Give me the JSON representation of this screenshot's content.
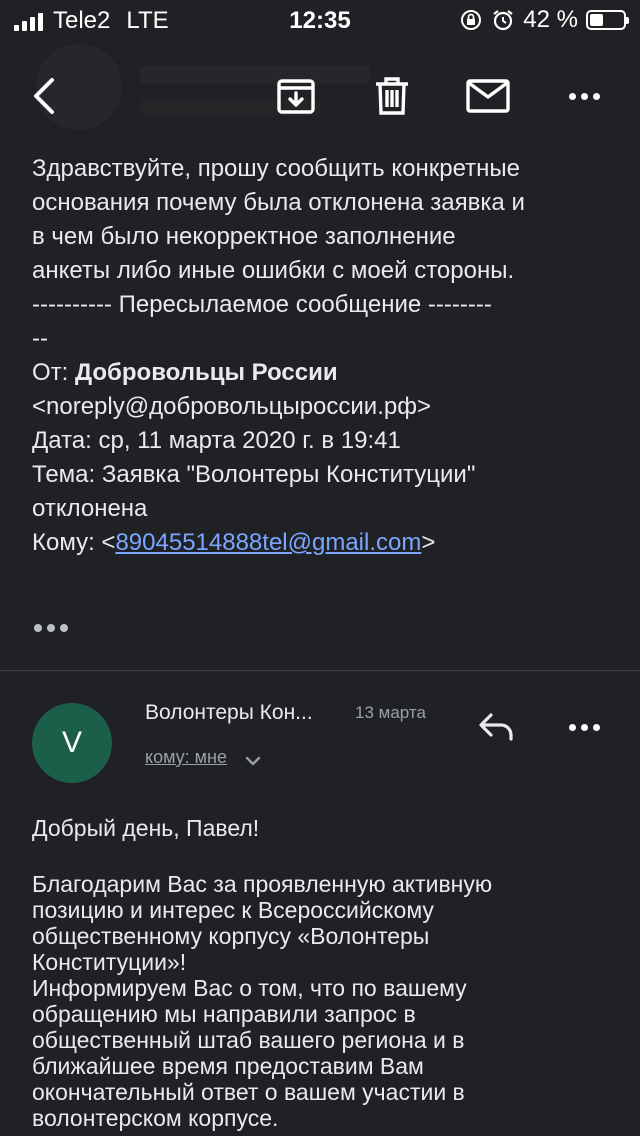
{
  "status_bar": {
    "carrier": "Tele2",
    "network": "LTE",
    "time": "12:35",
    "battery_percent": "42 %",
    "battery_level": 0.42
  },
  "toolbar": {
    "back_icon": "chevron-left-icon",
    "archive_icon": "archive-icon",
    "delete_icon": "trash-icon",
    "mark_unread_icon": "mail-icon",
    "more_icon": "more-horizontal-icon"
  },
  "message1": {
    "body_lines": [
      "Здравствуйте, прошу сообщить конкретные",
      "основания почему была отклонена заявка и",
      "в чем было некорректное заполнение",
      "анкеты либо иные ошибки с моей стороны."
    ],
    "forward_line1": "---------- Пересылаемое сообщение --------",
    "forward_line2": "--",
    "from_label": "От: ",
    "from_name": "Добровольцы России",
    "from_email": "<noreply@добровольцыроссии.рф>",
    "date_line": "Дата: ср, 11 марта 2020 г. в 19:41",
    "subject_line1": "Тема: Заявка \"Волонтеры Конституции\"",
    "subject_line2": "отклонена",
    "to_label": "Кому: <",
    "to_email": "89045514888tel@gmail.com",
    "to_close": ">"
  },
  "message2": {
    "avatar_letter": "V",
    "avatar_color": "#1b5e4a",
    "sender": "Волонтеры Кон...",
    "date": "13 марта",
    "recipient": "кому: мне",
    "greeting": "Добрый день, Павел!",
    "body_lines": [
      "Благодарим Вас за проявленную активную",
      "позицию и интерес к Всероссийскому",
      "общественному корпусу «Волонтеры",
      "Конституции»!",
      "Информируем Вас о том, что по вашему",
      "обращению мы направили запрос в",
      "общественный штаб вашего региона и в",
      "ближайшее время предоставим Вам",
      "окончательный ответ о вашем участии в",
      "волонтерском корпусе."
    ]
  },
  "colors": {
    "background": "#202124",
    "link": "#7aa6ff",
    "muted": "#9aa0a6"
  }
}
